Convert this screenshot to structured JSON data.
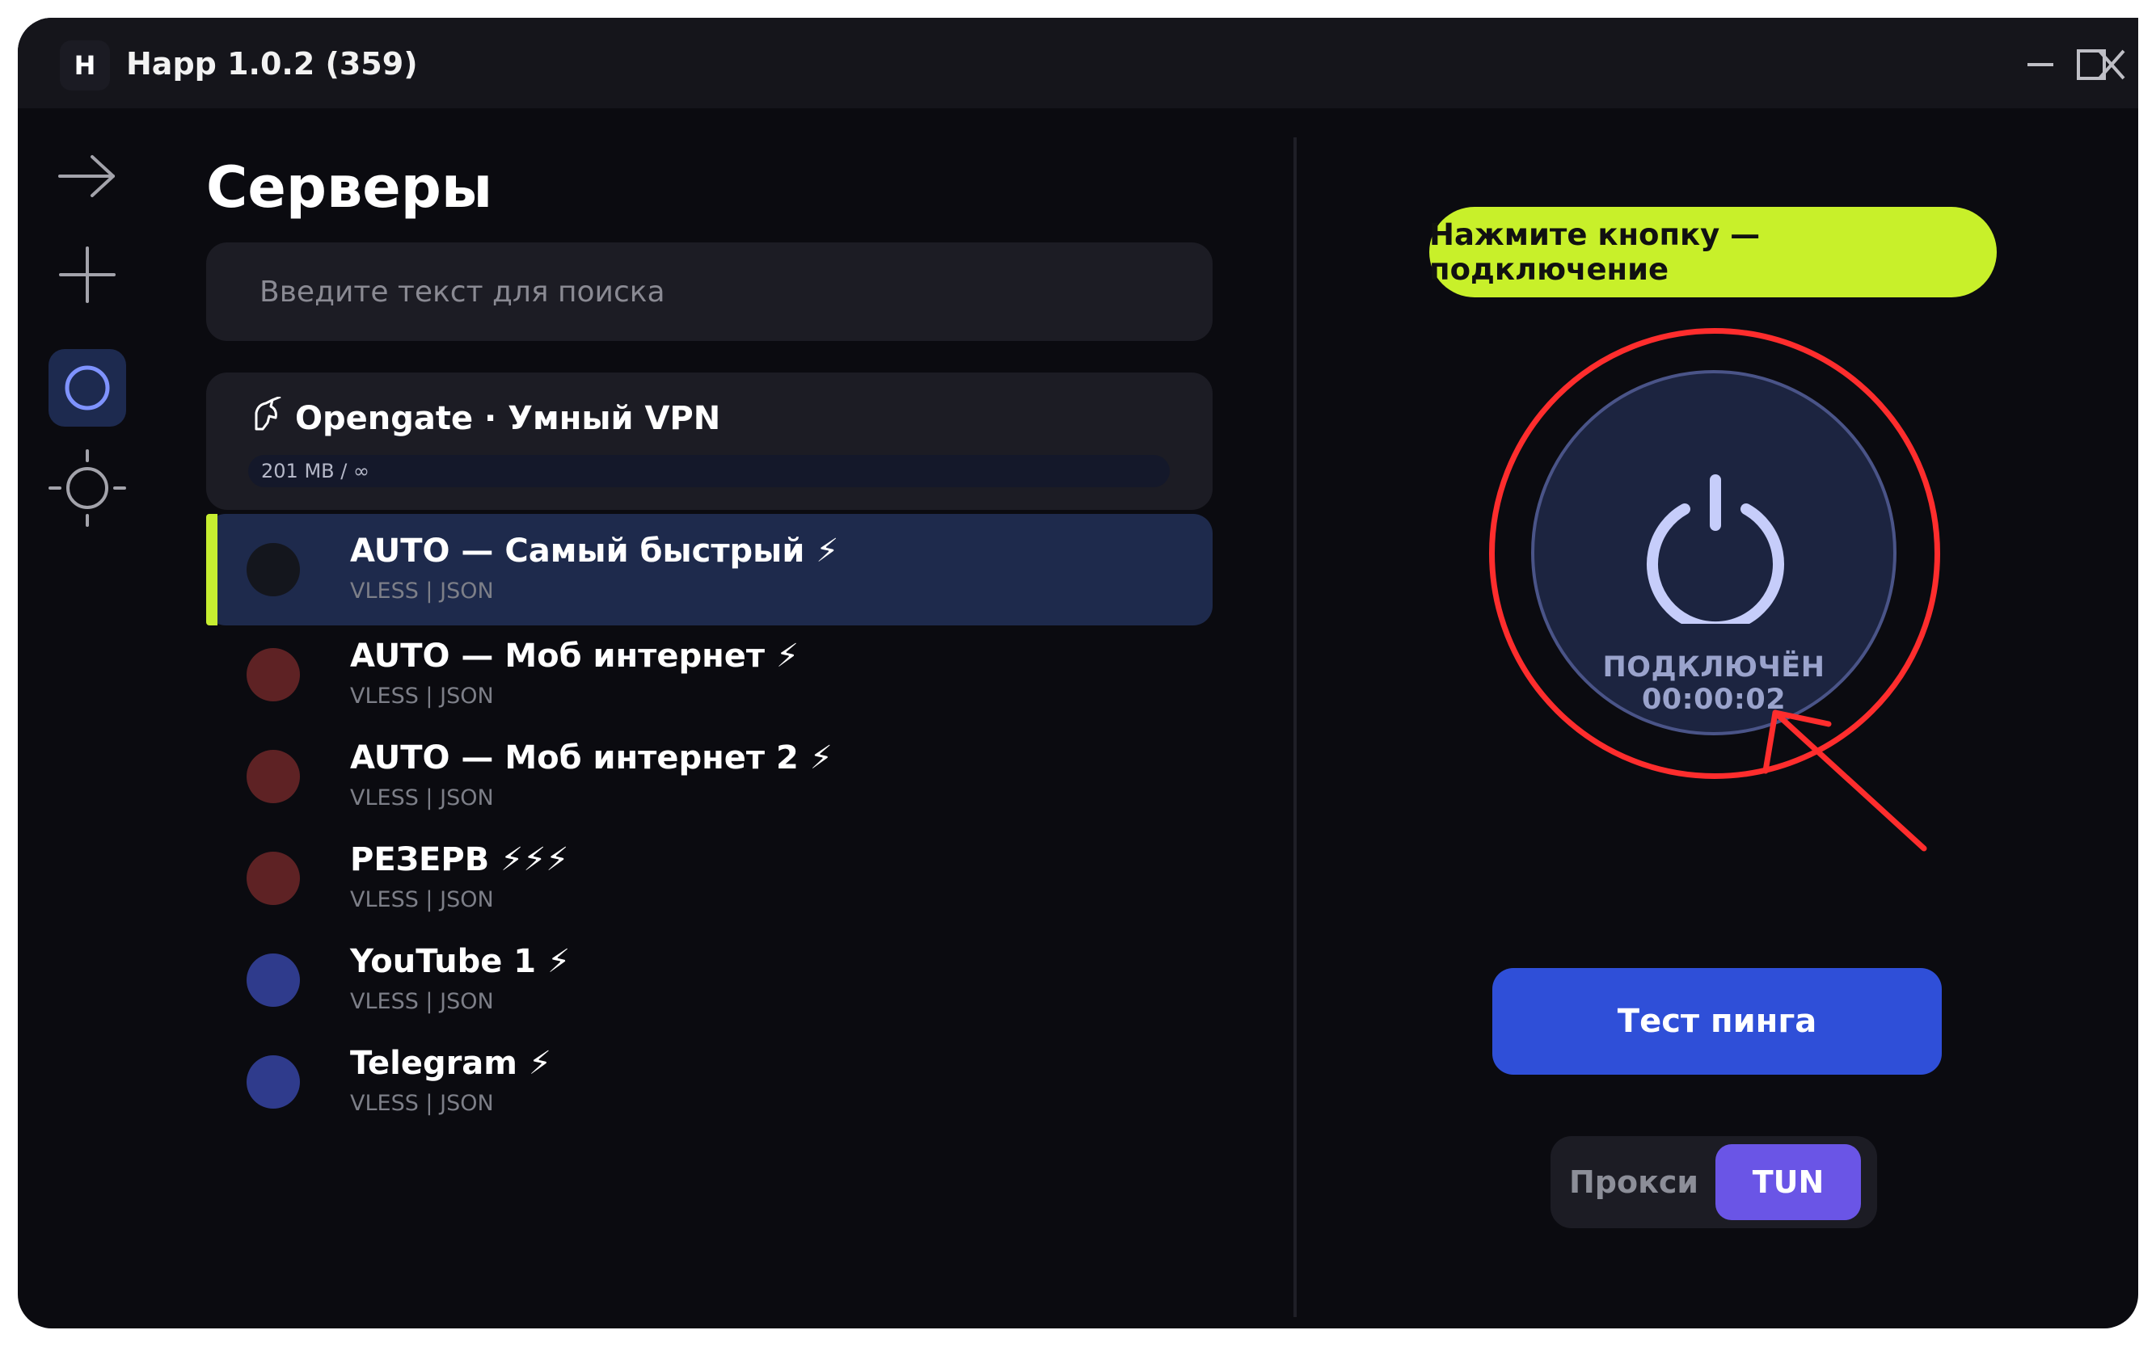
{
  "window": {
    "logo_letter": "H",
    "title": "Happ 1.0.2 (359)"
  },
  "sidebar": {
    "items": [
      {
        "icon": "arrow-right-icon"
      },
      {
        "icon": "plus-icon"
      },
      {
        "icon": "circle-icon",
        "active": true
      },
      {
        "icon": "crosshair-icon"
      }
    ]
  },
  "servers_panel": {
    "title": "Серверы",
    "search_placeholder": "Введите текст для поиска",
    "subscription": {
      "name": "Opengate · Умный VPN",
      "usage": "201 MB / ∞"
    },
    "servers": [
      {
        "name": "AUTO — Самый быстрый ⚡",
        "protocol": "VLESS | JSON",
        "status_color": "#14161d",
        "selected": true
      },
      {
        "name": "AUTO — Моб интернет ⚡",
        "protocol": "VLESS | JSON",
        "status_color": "#5e2224"
      },
      {
        "name": "AUTO — Моб интернет 2 ⚡",
        "protocol": "VLESS | JSON",
        "status_color": "#5e2224"
      },
      {
        "name": "РЕЗЕРВ ⚡⚡⚡",
        "protocol": "VLESS | JSON",
        "status_color": "#5e2224"
      },
      {
        "name": "YouTube 1 ⚡",
        "protocol": "VLESS | JSON",
        "status_color": "#2f3b8c"
      },
      {
        "name": "Telegram ⚡",
        "protocol": "VLESS | JSON",
        "status_color": "#2f3b8c"
      }
    ]
  },
  "connection": {
    "hint": "Нажмите кнопку — подключение",
    "status": "ПОДКЛЮЧЁН 00:00:02",
    "ping_button": "Тест пинга",
    "modes": {
      "proxy": "Прокси",
      "tun": "TUN",
      "selected": "tun"
    }
  },
  "colors": {
    "accent_green": "#c8f02a",
    "primary_blue": "#2f4fd8",
    "tun_purple": "#6a55e6",
    "annotation_red": "#ff2d2d"
  }
}
